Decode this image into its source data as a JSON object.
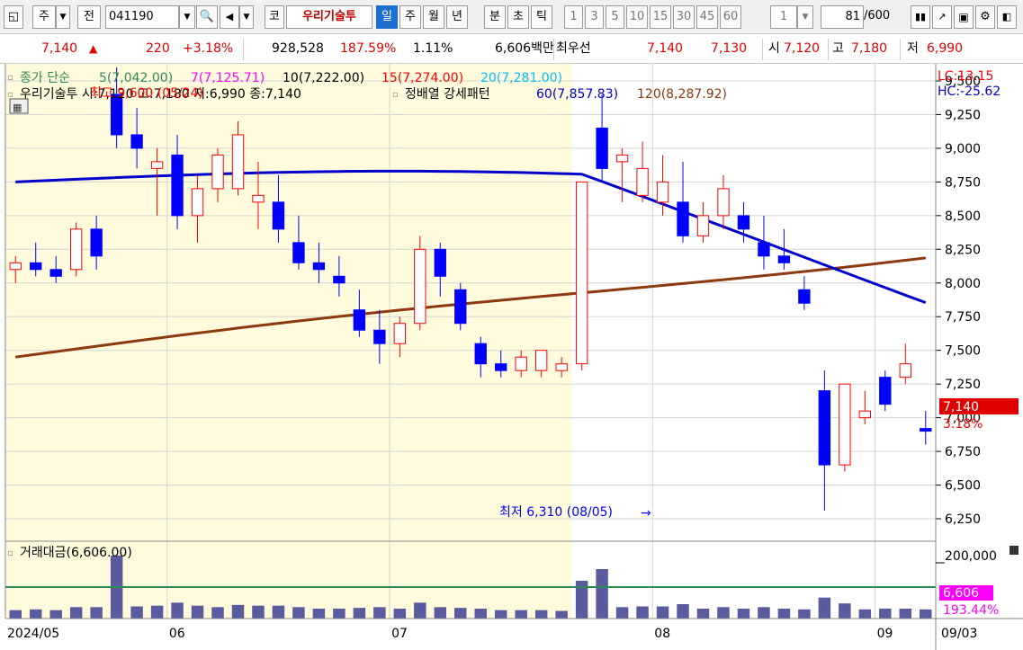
{
  "toolbar": {
    "market_type": "주",
    "all_label": "전",
    "code": "041190",
    "exchange_badge": "코",
    "stock_name": "우리기술투",
    "periods": [
      "일",
      "주",
      "월",
      "년"
    ],
    "intraday": [
      "분",
      "초",
      "틱"
    ],
    "intervals": [
      "1",
      "3",
      "5",
      "10",
      "15",
      "30",
      "45",
      "60"
    ],
    "multiplier": "1",
    "count": "81",
    "count_total": "/600",
    "active_period": "일"
  },
  "quote": {
    "price": "7,140",
    "arrow": "▲",
    "change": "220",
    "change_pct": "+3.18%",
    "volume": "928,528",
    "volume_ratio": "187.59%",
    "turnover": "1.11%",
    "amount": "6,606백만",
    "best_label": "최우선",
    "ask": "7,140",
    "bid": "7,130",
    "open_label": "시",
    "open": "7,120",
    "high_label": "고",
    "high": "7,180",
    "low_label": "저",
    "low": "6,990"
  },
  "legend": {
    "ma_title": "종가 단순",
    "ma5": "5(7,042.00)",
    "ma7": "7(7,125.71)",
    "ma10": "10(7,222.00)",
    "ma15": "15(7,274.00)",
    "ma20": "20(7,281.00)",
    "price_title": "우리기술투 시:7,120 고:7,180 저:6,990 종:7,140",
    "overlay_text": "최고 9,600 (05/24)",
    "pattern_title": "정배열 강세패턴",
    "ma60": "60(7,857.83)",
    "ma120": "120(8,287.92)",
    "lc": "LC:13.15",
    "hc": "HC:-25.62",
    "volume_title": "거래대금(6,606.00)"
  },
  "annotations": {
    "low_text": "최저 6,310 (08/05)"
  },
  "right_labels": {
    "price_tag": "7,140",
    "price_pct": "3.18%",
    "vol_tag": "6,606",
    "vol_pct": "193.44%",
    "vol_axis_top": "200,000"
  },
  "colors": {
    "candle_up": "#ff0000",
    "candle_down": "#0000ff",
    "ma5": "#2e8b57",
    "ma7": "#ff00ff",
    "ma10": "#000000",
    "ma15": "#ff0000",
    "ma20": "#00bfff",
    "ma60": "#0000cd",
    "ma120": "#8b3a0f",
    "highlight": "#fffbdc",
    "volume_bar": "#5a5a9e",
    "volume_line": "#2e8b57"
  },
  "chart_data": {
    "type": "candlestick",
    "y_ticks": [
      "9,500",
      "9,250",
      "9,000",
      "8,750",
      "8,500",
      "8,250",
      "8,000",
      "7,750",
      "7,500",
      "7,250",
      "7,000",
      "6,750",
      "6,500",
      "6,250"
    ],
    "y_tick_values": [
      9500,
      9250,
      9000,
      8750,
      8500,
      8250,
      8000,
      7750,
      7500,
      7250,
      7000,
      6750,
      6500,
      6250
    ],
    "ylim": [
      6150,
      9560
    ],
    "x_labels": [
      "2024/05",
      "06",
      "07",
      "08",
      "09"
    ],
    "x_label_index": [
      0,
      8,
      19,
      32,
      43
    ],
    "x_right_label": "09/03",
    "highlight_range": [
      0,
      27
    ],
    "bar_count": 46,
    "candles": [
      [
        8100,
        8200,
        8000,
        8150
      ],
      [
        8150,
        8300,
        8050,
        8100
      ],
      [
        8100,
        8200,
        8000,
        8050
      ],
      [
        8100,
        8450,
        8050,
        8400
      ],
      [
        8400,
        8500,
        8100,
        8200
      ],
      [
        9400,
        9600,
        9000,
        9100
      ],
      [
        9100,
        9300,
        8850,
        9000
      ],
      [
        8850,
        9000,
        8500,
        8900
      ],
      [
        8950,
        9100,
        8400,
        8500
      ],
      [
        8500,
        8800,
        8300,
        8700
      ],
      [
        8700,
        9000,
        8600,
        8950
      ],
      [
        8700,
        9200,
        8650,
        9100
      ],
      [
        8600,
        8900,
        8400,
        8650
      ],
      [
        8600,
        8800,
        8300,
        8400
      ],
      [
        8300,
        8500,
        8100,
        8150
      ],
      [
        8150,
        8300,
        8000,
        8100
      ],
      [
        8050,
        8200,
        7900,
        8000
      ],
      [
        7800,
        7950,
        7600,
        7650
      ],
      [
        7650,
        7800,
        7400,
        7550
      ],
      [
        7550,
        7750,
        7450,
        7700
      ],
      [
        7700,
        8350,
        7650,
        8250
      ],
      [
        8250,
        8300,
        7900,
        8050
      ],
      [
        7950,
        8000,
        7650,
        7700
      ],
      [
        7550,
        7600,
        7300,
        7400
      ],
      [
        7400,
        7500,
        7300,
        7350
      ],
      [
        7350,
        7500,
        7300,
        7450
      ],
      [
        7350,
        7500,
        7300,
        7500
      ],
      [
        7350,
        7450,
        7300,
        7400
      ],
      [
        7400,
        8750,
        7350,
        8750
      ],
      [
        9150,
        9400,
        8750,
        8850
      ],
      [
        8900,
        9000,
        8600,
        8950
      ],
      [
        8650,
        9050,
        8600,
        8850
      ],
      [
        8600,
        8950,
        8500,
        8750
      ],
      [
        8600,
        8900,
        8300,
        8350
      ],
      [
        8350,
        8600,
        8300,
        8500
      ],
      [
        8500,
        8800,
        8400,
        8700
      ],
      [
        8500,
        8600,
        8300,
        8400
      ],
      [
        8300,
        8500,
        8100,
        8200
      ],
      [
        8200,
        8400,
        8100,
        8150
      ],
      [
        7950,
        8050,
        7800,
        7850
      ],
      [
        7200,
        7350,
        6310,
        6650
      ],
      [
        6650,
        7250,
        6600,
        7250
      ],
      [
        7000,
        7200,
        6950,
        7050
      ],
      [
        7300,
        7350,
        7050,
        7100
      ],
      [
        7300,
        7550,
        7250,
        7400
      ],
      [
        6920,
        7050,
        6800,
        6900
      ]
    ]
  }
}
